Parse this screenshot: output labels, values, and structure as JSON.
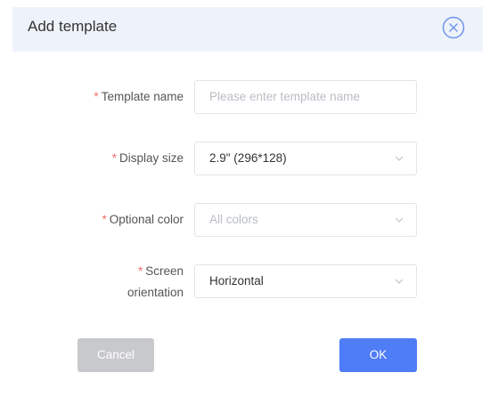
{
  "dialog": {
    "title": "Add template"
  },
  "form": {
    "template_name": {
      "label": "Template name",
      "required_mark": "*",
      "value": "",
      "placeholder": "Please enter template name"
    },
    "display_size": {
      "label": "Display size",
      "required_mark": "*",
      "selected": "2.9\" (296*128)"
    },
    "optional_color": {
      "label": "Optional color",
      "required_mark": "*",
      "placeholder": "All colors"
    },
    "screen_orientation": {
      "label_line1": "Screen",
      "label_line2": "orientation",
      "required_mark": "*",
      "selected": "Horizontal"
    }
  },
  "footer": {
    "cancel_label": "Cancel",
    "ok_label": "OK"
  },
  "colors": {
    "primary": "#4f7cf7",
    "required": "#f56c6c",
    "header_bg": "#eef3fb",
    "disabled_button": "#c8c9cc"
  },
  "icons": {
    "close": "close-circle-icon",
    "dropdown": "chevron-down-icon"
  }
}
